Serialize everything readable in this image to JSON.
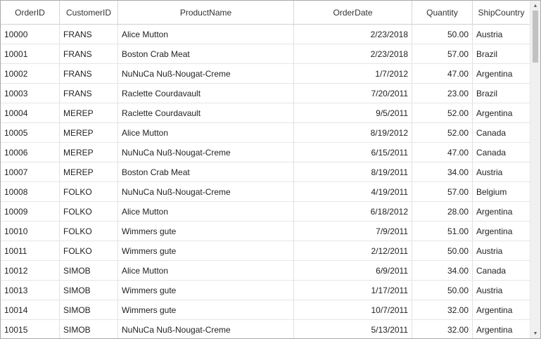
{
  "columns": [
    "OrderID",
    "CustomerID",
    "ProductName",
    "OrderDate",
    "Quantity",
    "ShipCountry"
  ],
  "rows": [
    [
      "10000",
      "FRANS",
      "Alice Mutton",
      "2/23/2018",
      "50.00",
      "Austria"
    ],
    [
      "10001",
      "FRANS",
      "Boston Crab Meat",
      "2/23/2018",
      "57.00",
      "Brazil"
    ],
    [
      "10002",
      "FRANS",
      "NuNuCa Nuß-Nougat-Creme",
      "1/7/2012",
      "47.00",
      "Argentina"
    ],
    [
      "10003",
      "FRANS",
      "Raclette Courdavault",
      "7/20/2011",
      "23.00",
      "Brazil"
    ],
    [
      "10004",
      "MEREP",
      "Raclette Courdavault",
      "9/5/2011",
      "52.00",
      "Argentina"
    ],
    [
      "10005",
      "MEREP",
      "Alice Mutton",
      "8/19/2012",
      "52.00",
      "Canada"
    ],
    [
      "10006",
      "MEREP",
      "NuNuCa Nuß-Nougat-Creme",
      "6/15/2011",
      "47.00",
      "Canada"
    ],
    [
      "10007",
      "MEREP",
      "Boston Crab Meat",
      "8/19/2011",
      "34.00",
      "Austria"
    ],
    [
      "10008",
      "FOLKO",
      "NuNuCa Nuß-Nougat-Creme",
      "4/19/2011",
      "57.00",
      "Belgium"
    ],
    [
      "10009",
      "FOLKO",
      "Alice Mutton",
      "6/18/2012",
      "28.00",
      "Argentina"
    ],
    [
      "10010",
      "FOLKO",
      "Wimmers gute",
      "7/9/2011",
      "51.00",
      "Argentina"
    ],
    [
      "10011",
      "FOLKO",
      "Wimmers gute",
      "2/12/2011",
      "50.00",
      "Austria"
    ],
    [
      "10012",
      "SIMOB",
      "Alice Mutton",
      "6/9/2011",
      "34.00",
      "Canada"
    ],
    [
      "10013",
      "SIMOB",
      "Wimmers gute",
      "1/17/2011",
      "50.00",
      "Austria"
    ],
    [
      "10014",
      "SIMOB",
      "Wimmers gute",
      "10/7/2011",
      "32.00",
      "Argentina"
    ],
    [
      "10015",
      "SIMOB",
      "NuNuCa Nuß-Nougat-Creme",
      "5/13/2011",
      "32.00",
      "Argentina"
    ]
  ],
  "scrollbar": {
    "up_icon": "chevron-up-icon",
    "down_icon": "chevron-down-icon"
  }
}
